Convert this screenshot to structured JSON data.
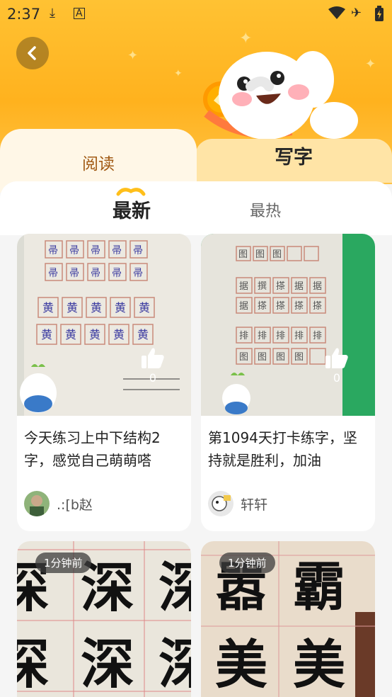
{
  "status_bar": {
    "time": "2:37",
    "icons": [
      "download-icon",
      "a-badge-icon",
      "wifi-icon",
      "airplane-icon",
      "battery-icon"
    ]
  },
  "header": {
    "back_icon": "chevron-left-icon"
  },
  "tabs": {
    "read": "阅读",
    "write": "写字"
  },
  "subtabs": {
    "latest": "最新",
    "hot": "最热"
  },
  "cards": [
    {
      "text": "今天练习上中下结构2字，感觉自己萌萌嗒",
      "user": ".:[b赵",
      "likes": "0"
    },
    {
      "text": "第1094天打卡练字，坚持就是胜利，加油",
      "user": "轩轩",
      "likes": "0"
    },
    {
      "time": "1分钟前"
    },
    {
      "time": "1分钟前"
    }
  ],
  "colors": {
    "header_bg": "#ffb21e",
    "tab_active_text": "#a15a14"
  }
}
